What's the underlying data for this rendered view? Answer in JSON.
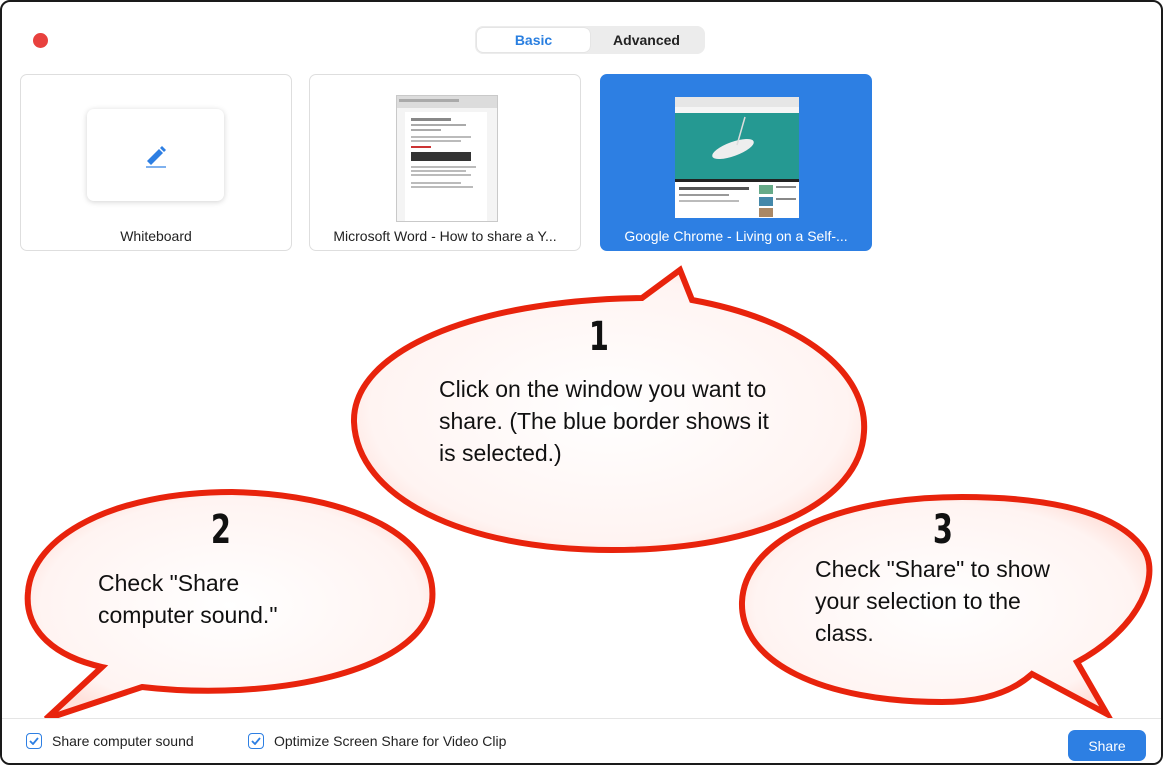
{
  "tabs": [
    {
      "label": "Basic",
      "active": true
    },
    {
      "label": "Advanced",
      "active": false
    }
  ],
  "tiles": [
    {
      "label": "Whiteboard",
      "selected": false,
      "icon": "pen-icon"
    },
    {
      "label": "Microsoft Word - How to share a Y...",
      "selected": false
    },
    {
      "label": "Google Chrome - Living on a Self-...",
      "selected": true
    }
  ],
  "options": {
    "share_sound": "Share computer sound",
    "optimize": "Optimize Screen Share for Video Clip"
  },
  "share_button": "Share",
  "callouts": [
    {
      "number": "1",
      "text": "Click on the window you want to share. (The blue border shows it is selected.)"
    },
    {
      "number": "2",
      "text": "Check \"Share computer sound.\""
    },
    {
      "number": "3",
      "text": "Check \"Share\" to show your selection to the class."
    }
  ],
  "colors": {
    "accent": "#2d7fe3",
    "callout_stroke": "#e8230c",
    "close": "#e8413e"
  }
}
